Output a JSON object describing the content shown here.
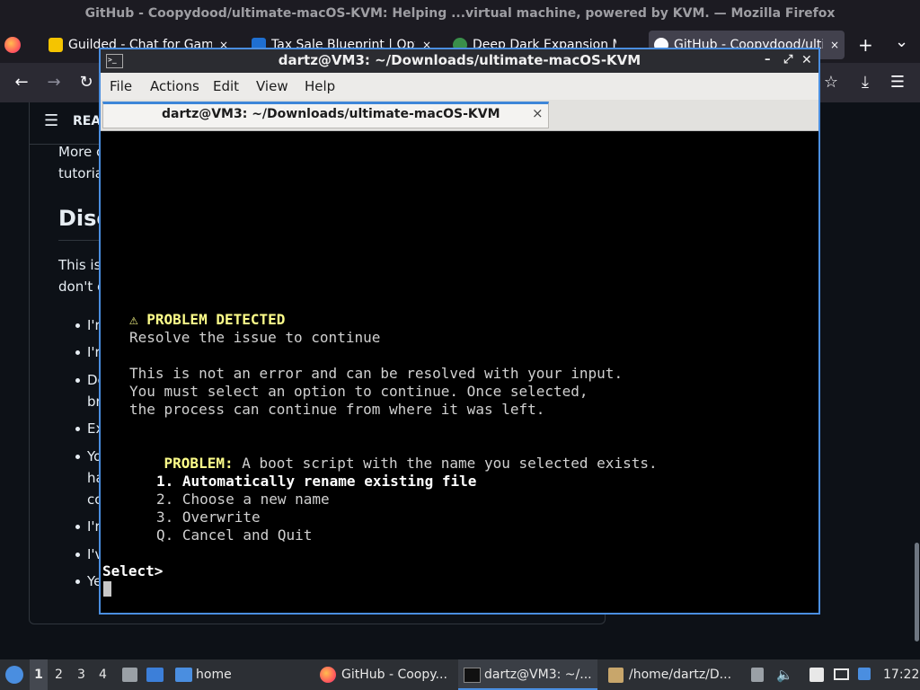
{
  "firefox": {
    "title": "GitHub - Coopydood/ultimate-macOS-KVM: Helping ...virtual machine, powered by KVM. — Mozilla Firefox",
    "tabs": [
      {
        "label": "Guilded - Chat for Gamin"
      },
      {
        "label": "Tax Sale Blueprint | Opt-I"
      },
      {
        "label": "Deep Dark Expansion Mo"
      },
      {
        "label": "GitHub - Coopydood/ultim"
      }
    ],
    "close_glyph": "×",
    "new_tab": "+",
    "tab_list": "⌄"
  },
  "github": {
    "readme_label": "REA",
    "lines": {
      "more": "More c",
      "tutorial": "tutoria",
      "heading": "Disc",
      "this_is": "This is",
      "dont": "don't e",
      "b1": "I'r",
      "b2": "I'r",
      "b3a": "De",
      "b3b": "br",
      "b4": "Ex",
      "b5a": "Yo",
      "b5b": "ha",
      "b5c": "co",
      "b6": "I'r",
      "b7": "I'v",
      "b8": "Ye"
    }
  },
  "terminal": {
    "title": "dartz@VM3: ~/Downloads/ultimate-macOS-KVM",
    "tab_title": "dartz@VM3: ~/Downloads/ultimate-macOS-KVM",
    "menu": [
      "File",
      "Actions",
      "Edit",
      "View",
      "Help"
    ],
    "controls": {
      "minimize": "–",
      "maximize": "⤢",
      "close": "✕"
    },
    "icon_glyph": ">_",
    "problem_heading": "⚠ PROBLEM DETECTED",
    "resolve": "Resolve the issue to continue",
    "line1": "This is not an error and can be resolved with your input.",
    "line2": "You must select an option to continue. Once selected,",
    "line3": "the process can continue from where it was left.",
    "problem_label": "PROBLEM:",
    "problem_text": " A boot script with the name you selected exists.",
    "options": [
      "1. Automatically rename existing file",
      "2. Choose a new name",
      "3. Overwrite",
      "Q. Cancel and Quit"
    ],
    "prompt": "Select>",
    "colors": {
      "accent_yellow": "#ffff8a",
      "border_blue": "#4a8ee0"
    }
  },
  "taskbar": {
    "workspaces": [
      "1",
      "2",
      "3",
      "4"
    ],
    "home_label": "home",
    "tasks": [
      {
        "label": "GitHub - Coopy..."
      },
      {
        "label": "dartz@VM3: ~/..."
      },
      {
        "label": "/home/dartz/D..."
      }
    ],
    "clock": "17:22"
  }
}
